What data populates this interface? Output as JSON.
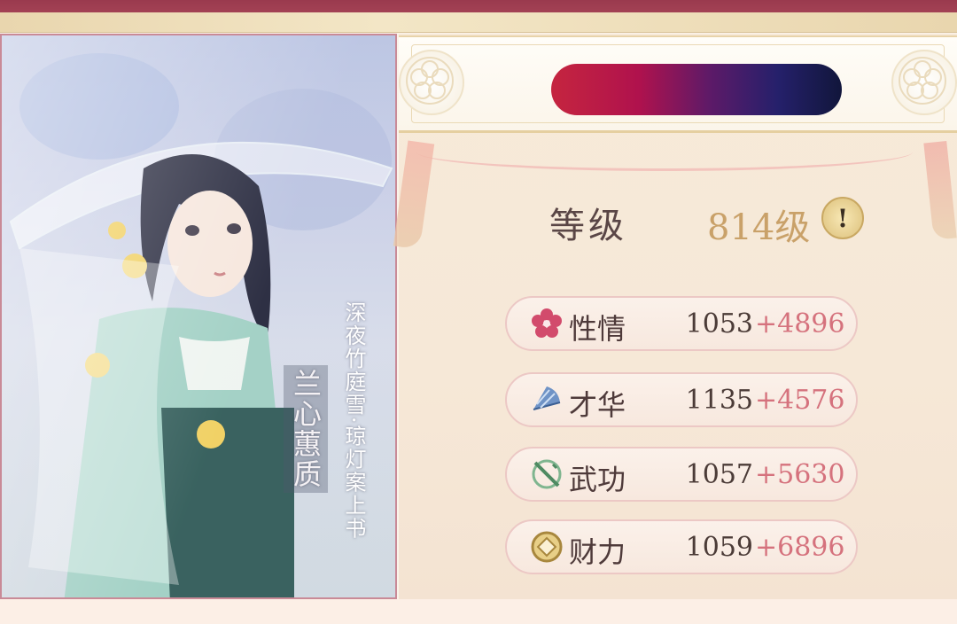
{
  "card": {
    "subtitle": "深夜竹庭雪·琼灯案上书",
    "name": "兰心蕙质"
  },
  "banner": {
    "player_name": ""
  },
  "level": {
    "label": "等级",
    "value": "814级",
    "info_icon": "!"
  },
  "stats": [
    {
      "icon": "plum-flower-icon",
      "label": "性情",
      "base": "1053",
      "bonus": "+4896",
      "color": "#d24b6c"
    },
    {
      "icon": "fan-icon",
      "label": "才华",
      "base": "1135",
      "bonus": "+4576",
      "color": "#5b7fb7"
    },
    {
      "icon": "sword-icon",
      "label": "武功",
      "base": "1057",
      "bonus": "+5630",
      "color": "#5c9a6f"
    },
    {
      "icon": "coin-icon",
      "label": "财力",
      "base": "1059",
      "bonus": "+6896",
      "color": "#c8a14a"
    }
  ]
}
